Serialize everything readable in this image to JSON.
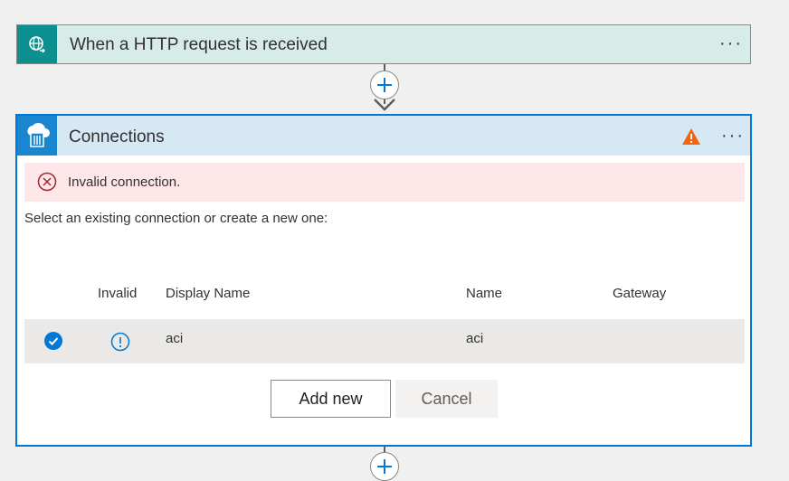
{
  "trigger": {
    "title": "When a HTTP request is received",
    "icon": "globe-request-icon",
    "menu_label": "···"
  },
  "connections_card": {
    "title": "Connections",
    "icon": "cloud-container-icon",
    "warning_icon": "warning-triangle-icon",
    "menu_label": "···",
    "error_message": "Invalid connection.",
    "instruction": "Select an existing connection or create a new one:",
    "table": {
      "columns": [
        "Invalid",
        "Display Name",
        "Name",
        "Gateway"
      ],
      "rows": [
        {
          "selected": true,
          "invalid": true,
          "display_name": "aci",
          "name": "aci",
          "gateway": ""
        }
      ]
    },
    "buttons": {
      "add_new": "Add new",
      "cancel": "Cancel"
    }
  },
  "colors": {
    "accent": "#0078d4",
    "trigger_header": "#d7ebe9",
    "trigger_icon_bg": "#0b8f8f",
    "connection_header": "#d7e8f5",
    "connection_icon_bg": "#1a86d0",
    "error_bg": "#fde7e9",
    "error_red": "#a4262c",
    "warning_orange": "#f7630c"
  }
}
